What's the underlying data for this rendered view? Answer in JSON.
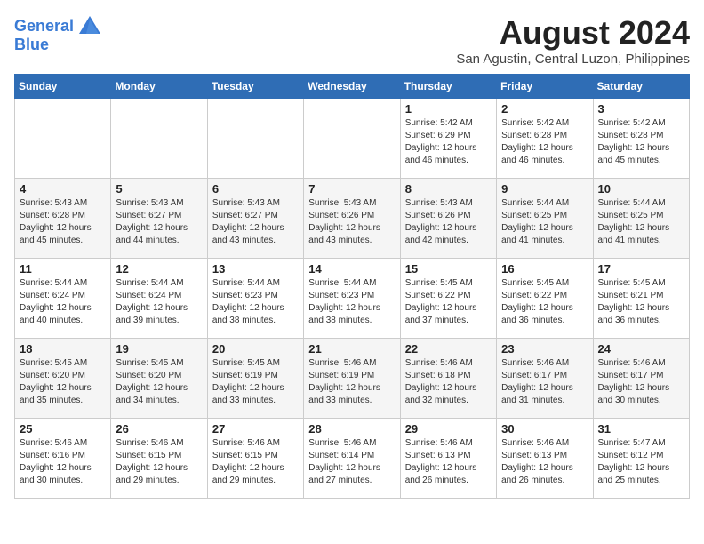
{
  "logo": {
    "line1": "General",
    "line2": "Blue"
  },
  "title": "August 2024",
  "subtitle": "San Agustin, Central Luzon, Philippines",
  "weekdays": [
    "Sunday",
    "Monday",
    "Tuesday",
    "Wednesday",
    "Thursday",
    "Friday",
    "Saturday"
  ],
  "weeks": [
    [
      {
        "day": "",
        "info": ""
      },
      {
        "day": "",
        "info": ""
      },
      {
        "day": "",
        "info": ""
      },
      {
        "day": "",
        "info": ""
      },
      {
        "day": "1",
        "info": "Sunrise: 5:42 AM\nSunset: 6:29 PM\nDaylight: 12 hours and 46 minutes."
      },
      {
        "day": "2",
        "info": "Sunrise: 5:42 AM\nSunset: 6:28 PM\nDaylight: 12 hours and 46 minutes."
      },
      {
        "day": "3",
        "info": "Sunrise: 5:42 AM\nSunset: 6:28 PM\nDaylight: 12 hours and 45 minutes."
      }
    ],
    [
      {
        "day": "4",
        "info": "Sunrise: 5:43 AM\nSunset: 6:28 PM\nDaylight: 12 hours and 45 minutes."
      },
      {
        "day": "5",
        "info": "Sunrise: 5:43 AM\nSunset: 6:27 PM\nDaylight: 12 hours and 44 minutes."
      },
      {
        "day": "6",
        "info": "Sunrise: 5:43 AM\nSunset: 6:27 PM\nDaylight: 12 hours and 43 minutes."
      },
      {
        "day": "7",
        "info": "Sunrise: 5:43 AM\nSunset: 6:26 PM\nDaylight: 12 hours and 43 minutes."
      },
      {
        "day": "8",
        "info": "Sunrise: 5:43 AM\nSunset: 6:26 PM\nDaylight: 12 hours and 42 minutes."
      },
      {
        "day": "9",
        "info": "Sunrise: 5:44 AM\nSunset: 6:25 PM\nDaylight: 12 hours and 41 minutes."
      },
      {
        "day": "10",
        "info": "Sunrise: 5:44 AM\nSunset: 6:25 PM\nDaylight: 12 hours and 41 minutes."
      }
    ],
    [
      {
        "day": "11",
        "info": "Sunrise: 5:44 AM\nSunset: 6:24 PM\nDaylight: 12 hours and 40 minutes."
      },
      {
        "day": "12",
        "info": "Sunrise: 5:44 AM\nSunset: 6:24 PM\nDaylight: 12 hours and 39 minutes."
      },
      {
        "day": "13",
        "info": "Sunrise: 5:44 AM\nSunset: 6:23 PM\nDaylight: 12 hours and 38 minutes."
      },
      {
        "day": "14",
        "info": "Sunrise: 5:44 AM\nSunset: 6:23 PM\nDaylight: 12 hours and 38 minutes."
      },
      {
        "day": "15",
        "info": "Sunrise: 5:45 AM\nSunset: 6:22 PM\nDaylight: 12 hours and 37 minutes."
      },
      {
        "day": "16",
        "info": "Sunrise: 5:45 AM\nSunset: 6:22 PM\nDaylight: 12 hours and 36 minutes."
      },
      {
        "day": "17",
        "info": "Sunrise: 5:45 AM\nSunset: 6:21 PM\nDaylight: 12 hours and 36 minutes."
      }
    ],
    [
      {
        "day": "18",
        "info": "Sunrise: 5:45 AM\nSunset: 6:20 PM\nDaylight: 12 hours and 35 minutes."
      },
      {
        "day": "19",
        "info": "Sunrise: 5:45 AM\nSunset: 6:20 PM\nDaylight: 12 hours and 34 minutes."
      },
      {
        "day": "20",
        "info": "Sunrise: 5:45 AM\nSunset: 6:19 PM\nDaylight: 12 hours and 33 minutes."
      },
      {
        "day": "21",
        "info": "Sunrise: 5:46 AM\nSunset: 6:19 PM\nDaylight: 12 hours and 33 minutes."
      },
      {
        "day": "22",
        "info": "Sunrise: 5:46 AM\nSunset: 6:18 PM\nDaylight: 12 hours and 32 minutes."
      },
      {
        "day": "23",
        "info": "Sunrise: 5:46 AM\nSunset: 6:17 PM\nDaylight: 12 hours and 31 minutes."
      },
      {
        "day": "24",
        "info": "Sunrise: 5:46 AM\nSunset: 6:17 PM\nDaylight: 12 hours and 30 minutes."
      }
    ],
    [
      {
        "day": "25",
        "info": "Sunrise: 5:46 AM\nSunset: 6:16 PM\nDaylight: 12 hours and 30 minutes."
      },
      {
        "day": "26",
        "info": "Sunrise: 5:46 AM\nSunset: 6:15 PM\nDaylight: 12 hours and 29 minutes."
      },
      {
        "day": "27",
        "info": "Sunrise: 5:46 AM\nSunset: 6:15 PM\nDaylight: 12 hours and 29 minutes."
      },
      {
        "day": "28",
        "info": "Sunrise: 5:46 AM\nSunset: 6:14 PM\nDaylight: 12 hours and 27 minutes."
      },
      {
        "day": "29",
        "info": "Sunrise: 5:46 AM\nSunset: 6:13 PM\nDaylight: 12 hours and 26 minutes."
      },
      {
        "day": "30",
        "info": "Sunrise: 5:46 AM\nSunset: 6:13 PM\nDaylight: 12 hours and 26 minutes."
      },
      {
        "day": "31",
        "info": "Sunrise: 5:47 AM\nSunset: 6:12 PM\nDaylight: 12 hours and 25 minutes."
      }
    ]
  ]
}
